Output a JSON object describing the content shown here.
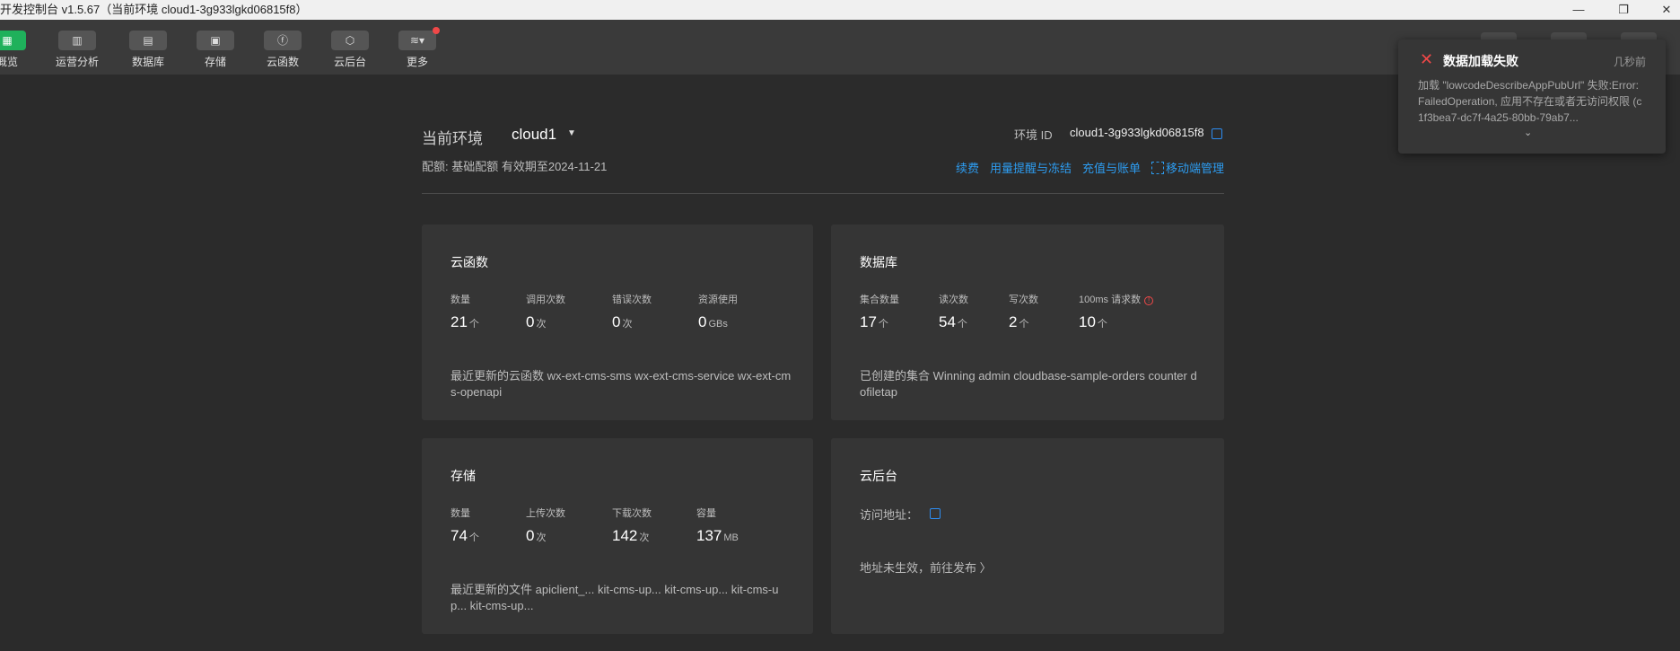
{
  "window": {
    "title": "开发控制台 v1.5.67（当前环境 cloud1-3g933lgkd06815f8）"
  },
  "toolbar": {
    "items": [
      {
        "label": "概览",
        "icon": "grid-icon"
      },
      {
        "label": "运营分析",
        "icon": "bar-chart-icon"
      },
      {
        "label": "数据库",
        "icon": "database-icon"
      },
      {
        "label": "存储",
        "icon": "storage-icon"
      },
      {
        "label": "云函数",
        "icon": "function-icon"
      },
      {
        "label": "云后台",
        "icon": "cube-icon"
      },
      {
        "label": "更多",
        "icon": "layers-icon"
      }
    ]
  },
  "env": {
    "label": "当前环境",
    "name": "cloud1",
    "quota": "配额: 基础配额  有效期至2024-11-21",
    "id_label": "环境 ID",
    "id_value": "cloud1-3g933lgkd06815f8",
    "links": [
      "续费",
      "用量提醒与冻结",
      "充值与账单",
      "移动端管理"
    ]
  },
  "cards": {
    "functions": {
      "title": "云函数",
      "stats": [
        {
          "label": "数量",
          "value": "21",
          "unit": "个"
        },
        {
          "label": "调用次数",
          "value": "0",
          "unit": "次"
        },
        {
          "label": "错误次数",
          "value": "0",
          "unit": "次"
        },
        {
          "label": "资源使用",
          "value": "0",
          "unit": "GBs"
        }
      ],
      "recent": "最近更新的云函数  wx-ext-cms-sms  wx-ext-cms-service  wx-ext-cms-openapi"
    },
    "database": {
      "title": "数据库",
      "stats": [
        {
          "label": "集合数量",
          "value": "17",
          "unit": "个"
        },
        {
          "label": "读次数",
          "value": "54",
          "unit": "个"
        },
        {
          "label": "写次数",
          "value": "2",
          "unit": "个"
        },
        {
          "label": "100ms 请求数",
          "value": "10",
          "unit": "个"
        }
      ],
      "recent": "已创建的集合  Winning  admin  cloudbase-sample-orders  counter  dofiletap"
    },
    "storage": {
      "title": "存储",
      "stats": [
        {
          "label": "数量",
          "value": "74",
          "unit": "个"
        },
        {
          "label": "上传次数",
          "value": "0",
          "unit": "次"
        },
        {
          "label": "下载次数",
          "value": "142",
          "unit": "次"
        },
        {
          "label": "容量",
          "value": "137",
          "unit": "MB"
        }
      ],
      "recent": "最近更新的文件  apiclient_...  kit-cms-up...  kit-cms-up...  kit-cms-up...  kit-cms-up..."
    },
    "backend": {
      "title": "云后台",
      "access_label": "访问地址：",
      "publish_hint": "地址未生效，前往发布 〉"
    }
  },
  "toast": {
    "title": "数据加载失败",
    "time": "几秒前",
    "message": "加载 \"lowcodeDescribeAppPubUrl\" 失败:Error: FailedOperation, 应用不存在或者无访问权限 (c1f3bea7-dc7f-4a25-80bb-79ab7...",
    "expand": "⌄"
  }
}
